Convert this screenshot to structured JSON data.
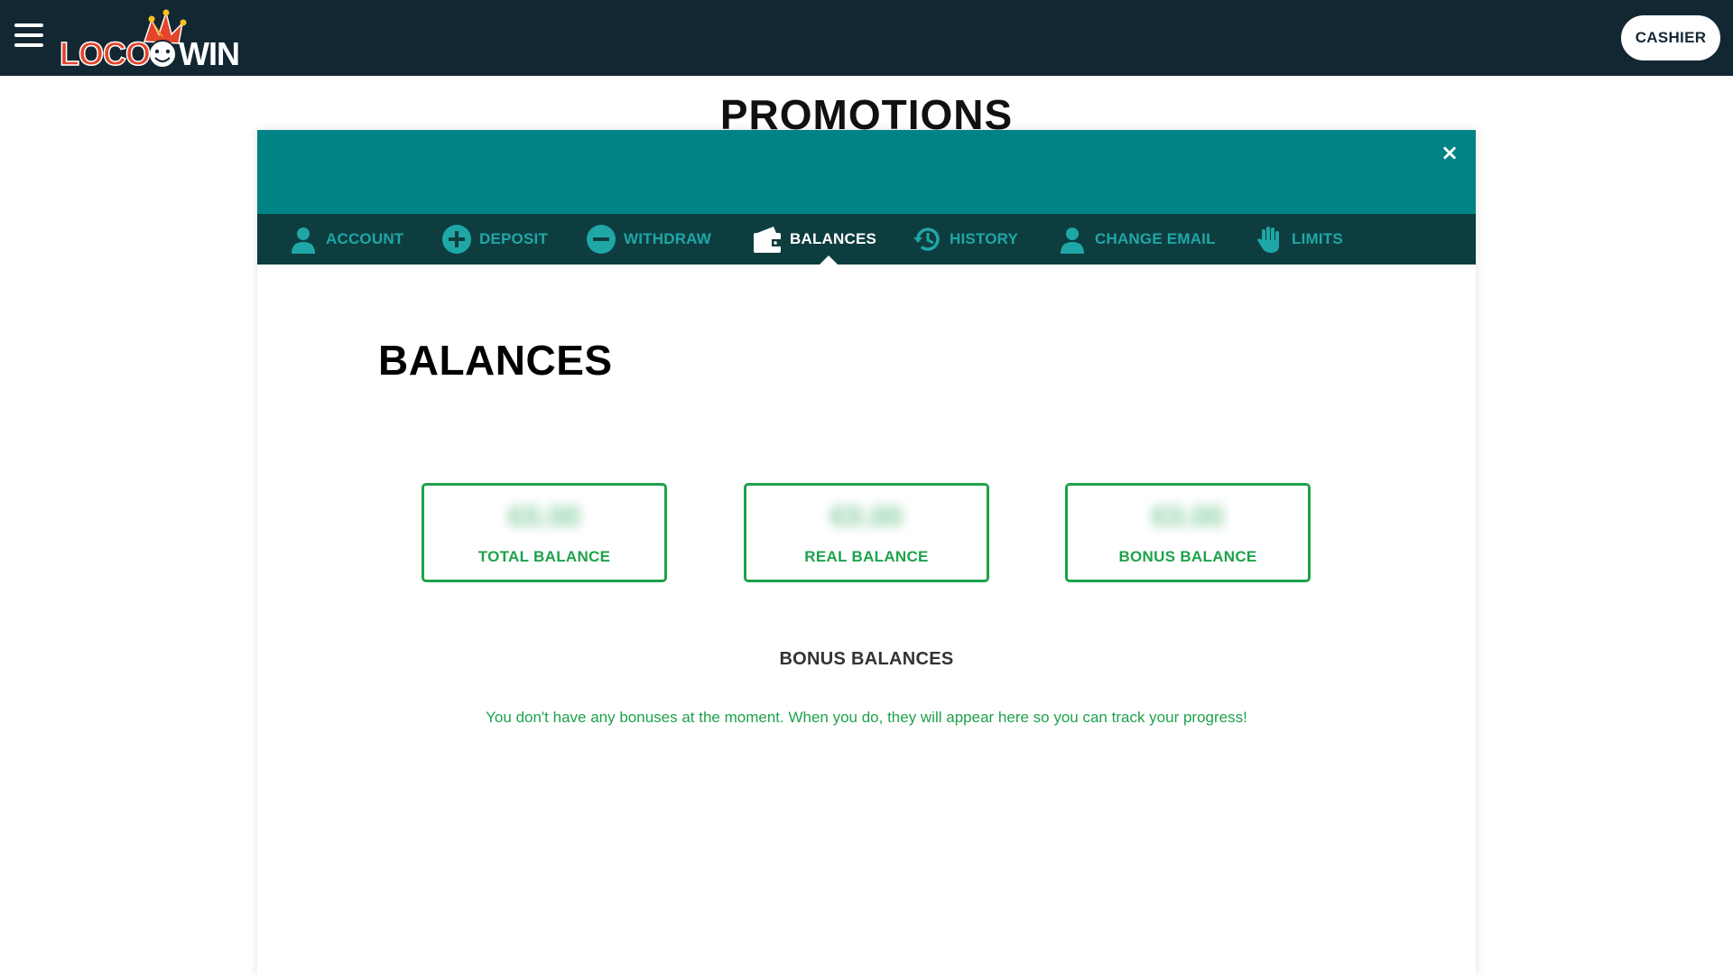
{
  "header": {
    "logo_text_left": "LOCO",
    "logo_text_right": "WIN",
    "cashier_label": "CASHIER"
  },
  "page": {
    "title": "PROMOTIONS"
  },
  "modal": {
    "close_label": "×",
    "tabs": [
      {
        "label": "ACCOUNT",
        "icon": "user-icon",
        "active": false
      },
      {
        "label": "DEPOSIT",
        "icon": "plus-circle-icon",
        "active": false
      },
      {
        "label": "WITHDRAW",
        "icon": "minus-circle-icon",
        "active": false
      },
      {
        "label": "BALANCES",
        "icon": "wallet-icon",
        "active": true
      },
      {
        "label": "HISTORY",
        "icon": "history-icon",
        "active": false
      },
      {
        "label": "CHANGE EMAIL",
        "icon": "user-icon",
        "active": false
      },
      {
        "label": "LIMITS",
        "icon": "hand-icon",
        "active": false
      }
    ],
    "heading": "BALANCES",
    "balances": [
      {
        "amount": "€0.00",
        "label": "TOTAL BALANCE"
      },
      {
        "amount": "€0.00",
        "label": "REAL BALANCE"
      },
      {
        "amount": "€0.00",
        "label": "BONUS BALANCE"
      }
    ],
    "bonus_heading": "BONUS BALANCES",
    "bonus_message": "You don't have any bonuses at the moment. When you do, they will appear here so you can track your progress!"
  },
  "colors": {
    "topbar": "#132733",
    "modal_header": "#008385",
    "tab_bar": "#0e3d40",
    "tab_text": "#1fa7a7",
    "accent_green": "#1ea24b",
    "logo_red": "#e2452a"
  }
}
